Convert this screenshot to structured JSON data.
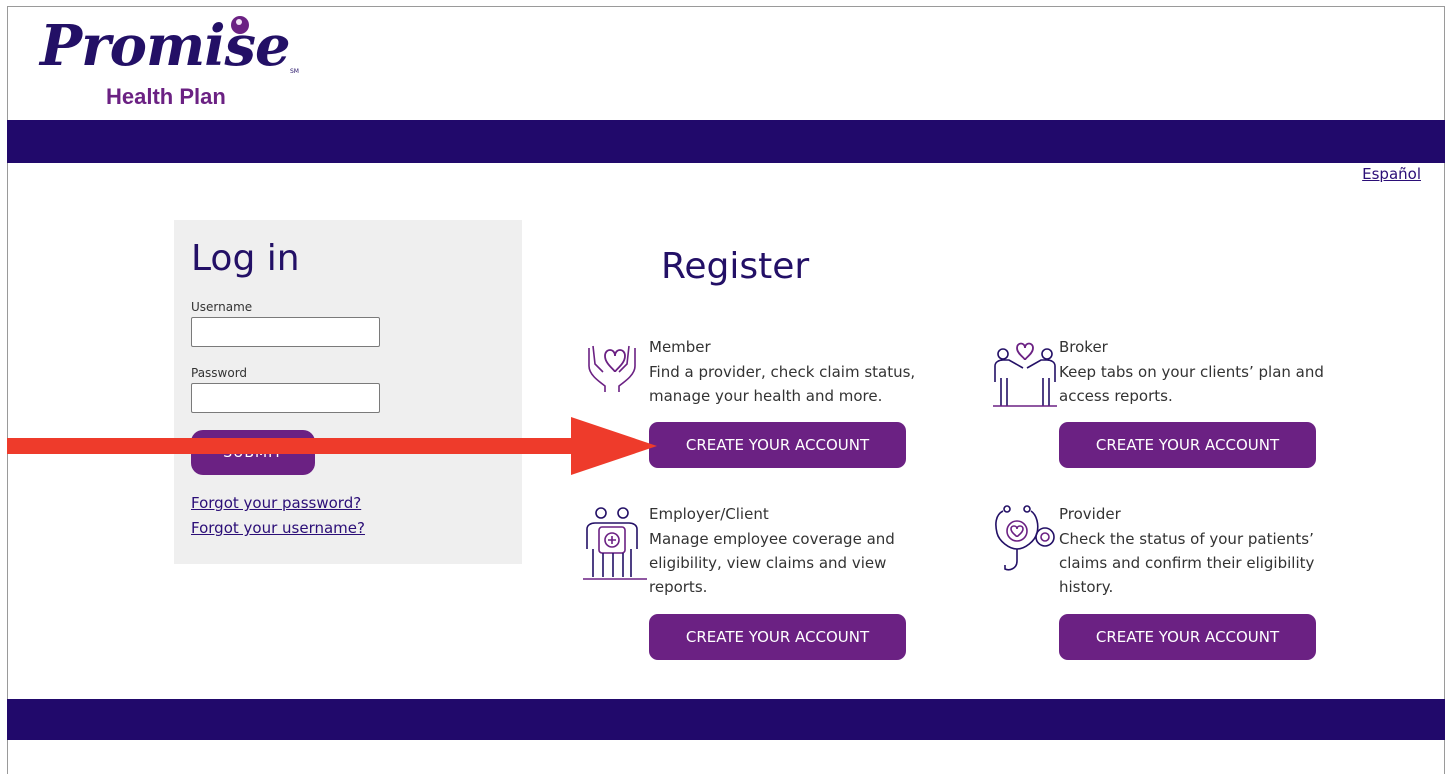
{
  "brand": {
    "name": "Promise",
    "mark": "SM",
    "subtitle": "Health Plan",
    "primary_color": "#21096b",
    "accent_color": "#6b2183",
    "arrow_color": "#ee3b2b"
  },
  "header": {
    "language_link": "Español"
  },
  "login": {
    "title": "Log in",
    "username_label": "Username",
    "username_value": "",
    "password_label": "Password",
    "password_value": "",
    "submit_label": "SUBMIT",
    "forgot_password": "Forgot your password?",
    "forgot_username": "Forgot your username?"
  },
  "register": {
    "title": "Register",
    "cards": [
      {
        "icon": "hands-heart-icon",
        "title": "Member",
        "description": "Find a provider, check claim status, manage your health and more.",
        "button_label": "CREATE YOUR ACCOUNT"
      },
      {
        "icon": "people-heart-icon",
        "title": "Broker",
        "description": "Keep tabs on your clients’ plan and access reports.",
        "button_label": "CREATE YOUR ACCOUNT"
      },
      {
        "icon": "employer-medical-icon",
        "title": "Employer/Client",
        "description": "Manage employee coverage and eligibility, view claims and view reports.",
        "button_label": "CREATE YOUR ACCOUNT"
      },
      {
        "icon": "stethoscope-heart-icon",
        "title": "Provider",
        "description": "Check the status of your patients’ claims and confirm their eligibility history.",
        "button_label": "CREATE YOUR ACCOUNT"
      }
    ]
  }
}
